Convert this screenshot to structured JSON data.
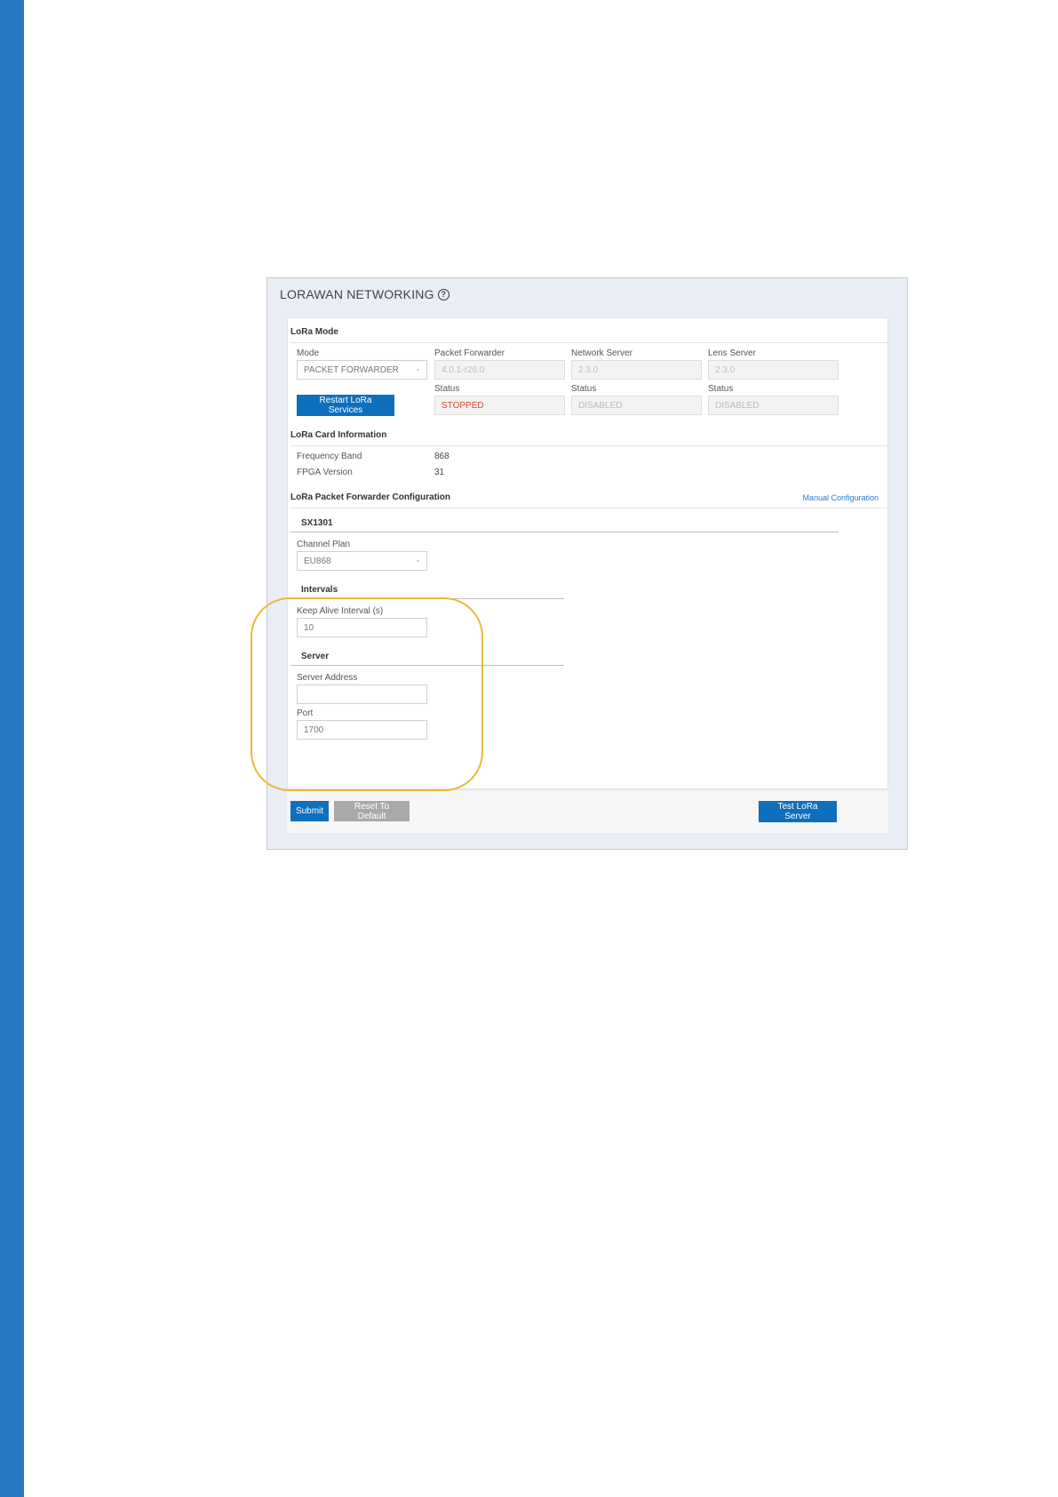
{
  "panel": {
    "title": "LORAWAN NETWORKING",
    "help_icon": "question-circle-icon"
  },
  "lora_mode": {
    "heading": "LoRa Mode",
    "mode_label": "Mode",
    "mode_value": "PACKET FORWARDER",
    "packet_forwarder_label": "Packet Forwarder",
    "packet_forwarder_value": "4.0.1-r26.0",
    "network_server_label": "Network Server",
    "network_server_value": "2.3.0",
    "lens_server_label": "Lens Server",
    "lens_server_value": "2.3.0",
    "restart_button": "Restart LoRa Services",
    "status_label": "Status",
    "pf_status": "STOPPED",
    "ns_status": "DISABLED",
    "ls_status": "DISABLED"
  },
  "card_info": {
    "heading": "LoRa Card Information",
    "frequency_band_label": "Frequency Band",
    "frequency_band_value": "868",
    "fpga_version_label": "FPGA Version",
    "fpga_version_value": "31"
  },
  "pf_config": {
    "heading": "LoRa Packet Forwarder Configuration",
    "manual_link": "Manual Configuration",
    "sx_heading": "SX1301",
    "channel_plan_label": "Channel Plan",
    "channel_plan_value": "EU868",
    "intervals_heading": "Intervals",
    "keep_alive_label": "Keep Alive Interval (s)",
    "keep_alive_value": "10",
    "server_heading": "Server",
    "server_address_label": "Server Address",
    "server_address_value": "",
    "port_label": "Port",
    "port_value": "1700"
  },
  "footer": {
    "submit": "Submit",
    "reset": "Reset To Default",
    "test": "Test LoRa Server"
  },
  "colors": {
    "accent": "#0e6fbd",
    "left_bar": "#2878c4",
    "highlight": "#e8b93a",
    "stopped": "#e0472d"
  }
}
